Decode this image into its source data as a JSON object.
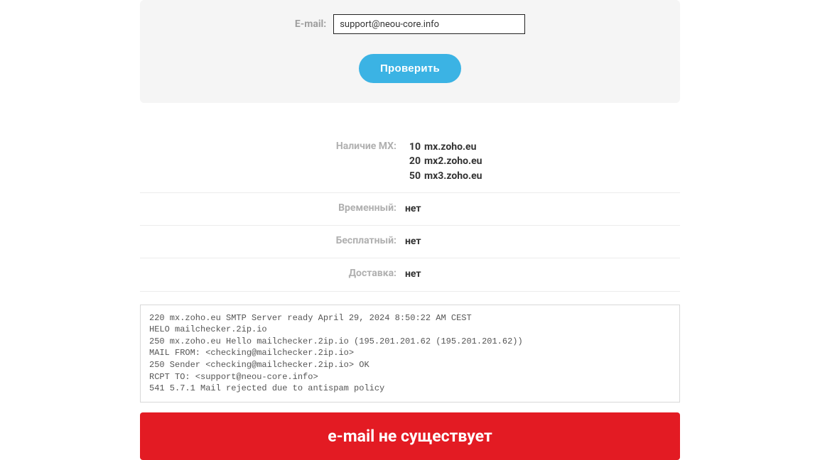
{
  "form": {
    "email_label": "E-mail:",
    "email_value": "support@neou-core.info",
    "submit_label": "Проверить"
  },
  "results": {
    "mx_label": "Наличие MX:",
    "mx_records": [
      {
        "priority": "10",
        "host": "mx.zoho.eu"
      },
      {
        "priority": "20",
        "host": "mx2.zoho.eu"
      },
      {
        "priority": "50",
        "host": "mx3.zoho.eu"
      }
    ],
    "temporary_label": "Временный:",
    "temporary_value": "нет",
    "free_label": "Бесплатный:",
    "free_value": "нет",
    "delivery_label": "Доставка:",
    "delivery_value": "нет"
  },
  "smtp_log": "220 mx.zoho.eu SMTP Server ready April 29, 2024 8:50:22 AM CEST\nHELO mailchecker.2ip.io\n250 mx.zoho.eu Hello mailchecker.2ip.io (195.201.201.62 (195.201.201.62))\nMAIL FROM: <checking@mailchecker.2ip.io>\n250 Sender <checking@mailchecker.2ip.io> OK\nRCPT TO: <support@neou-core.info>\n541 5.7.1 Mail rejected due to antispam policy",
  "status_message": "e-mail не существует"
}
